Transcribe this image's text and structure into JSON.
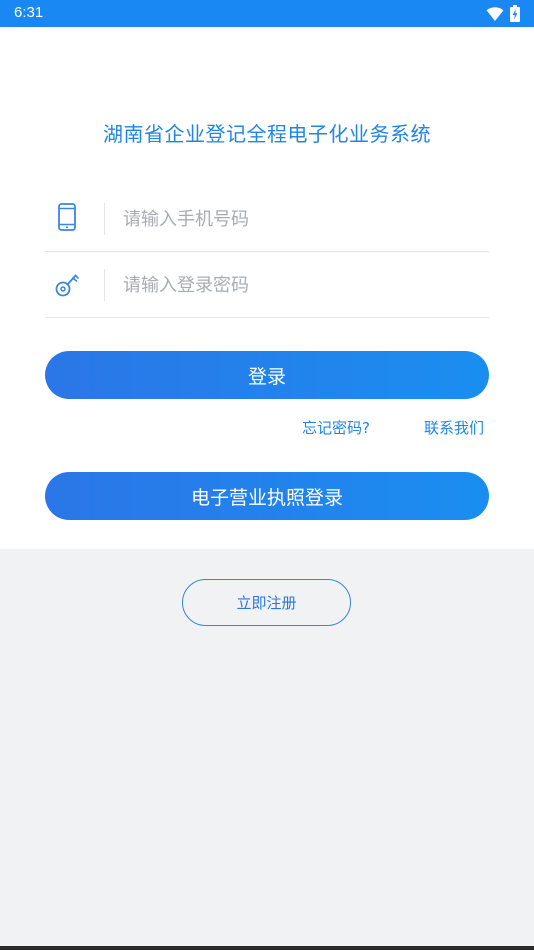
{
  "status_bar": {
    "time": "6:31"
  },
  "app": {
    "title": "湖南省企业登记全程电子化业务系统"
  },
  "login_form": {
    "phone_placeholder": "请输入手机号码",
    "password_placeholder": "请输入登录密码",
    "login_button": "登录",
    "forgot_password": "忘记密码?",
    "contact_us": "联系我们",
    "license_login_button": "电子营业执照登录"
  },
  "register": {
    "label": "立即注册"
  },
  "colors": {
    "primary": "#1a88f2",
    "gradient_start": "#2b76e8",
    "gradient_end": "#1a8ef0",
    "panel_bg": "#f1f2f4"
  },
  "icons": {
    "phone_field": "mobile-phone-icon",
    "password_field": "key-icon"
  }
}
